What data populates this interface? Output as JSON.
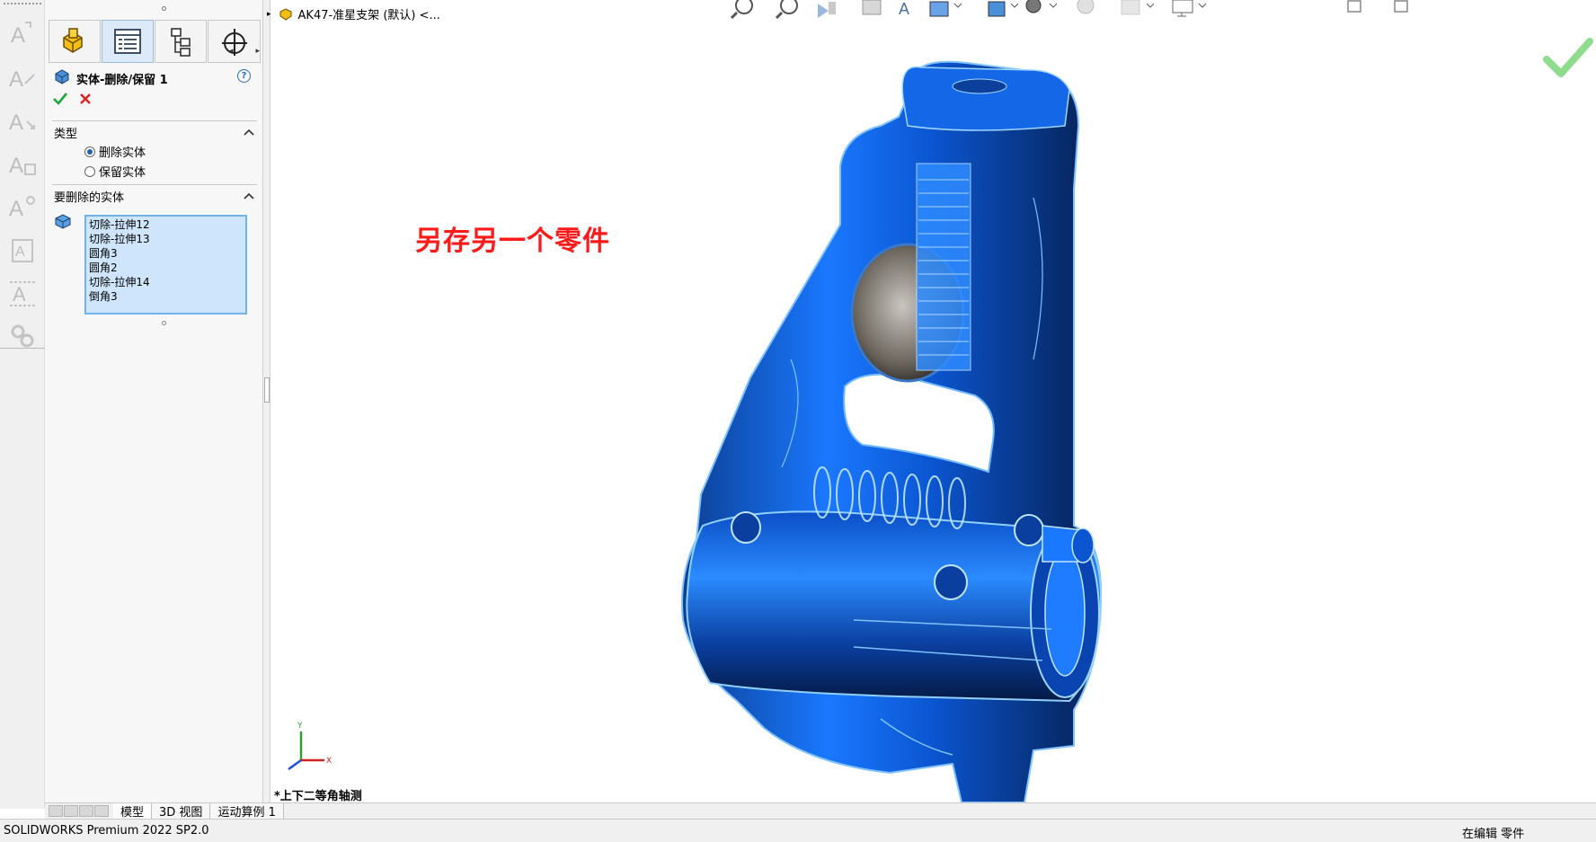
{
  "document": {
    "breadcrumb_title": "AK47-准星支架 (默认) <..."
  },
  "property_manager": {
    "title": "实体-删除/保留 1",
    "help_symbol": "?",
    "type_section": {
      "title": "类型",
      "options": [
        {
          "label": "删除实体",
          "selected": true
        },
        {
          "label": "保留实体",
          "selected": false
        }
      ]
    },
    "bodies_section": {
      "title": "要删除的实体",
      "items": [
        "切除-拉伸12",
        "切除-拉伸13",
        "圆角3",
        "圆角2",
        "切除-拉伸14",
        "倒角3"
      ]
    }
  },
  "viewport": {
    "annotation": "另存另一个零件",
    "view_orientation": "*上下二等角轴测",
    "annotation_color": "#ff1a1a",
    "model_color": "#1a78ff",
    "triad": {
      "x_label": "X",
      "y_label": "Y"
    }
  },
  "bottom_tabs": [
    "模型",
    "3D 视图",
    "运动算例 1"
  ],
  "status_bar": {
    "left": "SOLIDWORKS Premium 2022 SP2.0",
    "right": "在编辑 零件"
  },
  "icons": {
    "left_tools": [
      "smart-dimension-icon",
      "note-icon",
      "balloon-icon",
      "weld-symbol-icon",
      "datum-icon",
      "surface-finish-icon",
      "geometric-tolerance-icon",
      "chain-link-icon"
    ],
    "tabs": [
      "feature-manager-icon",
      "property-manager-icon",
      "configuration-manager-icon",
      "dimxpert-icon"
    ]
  }
}
